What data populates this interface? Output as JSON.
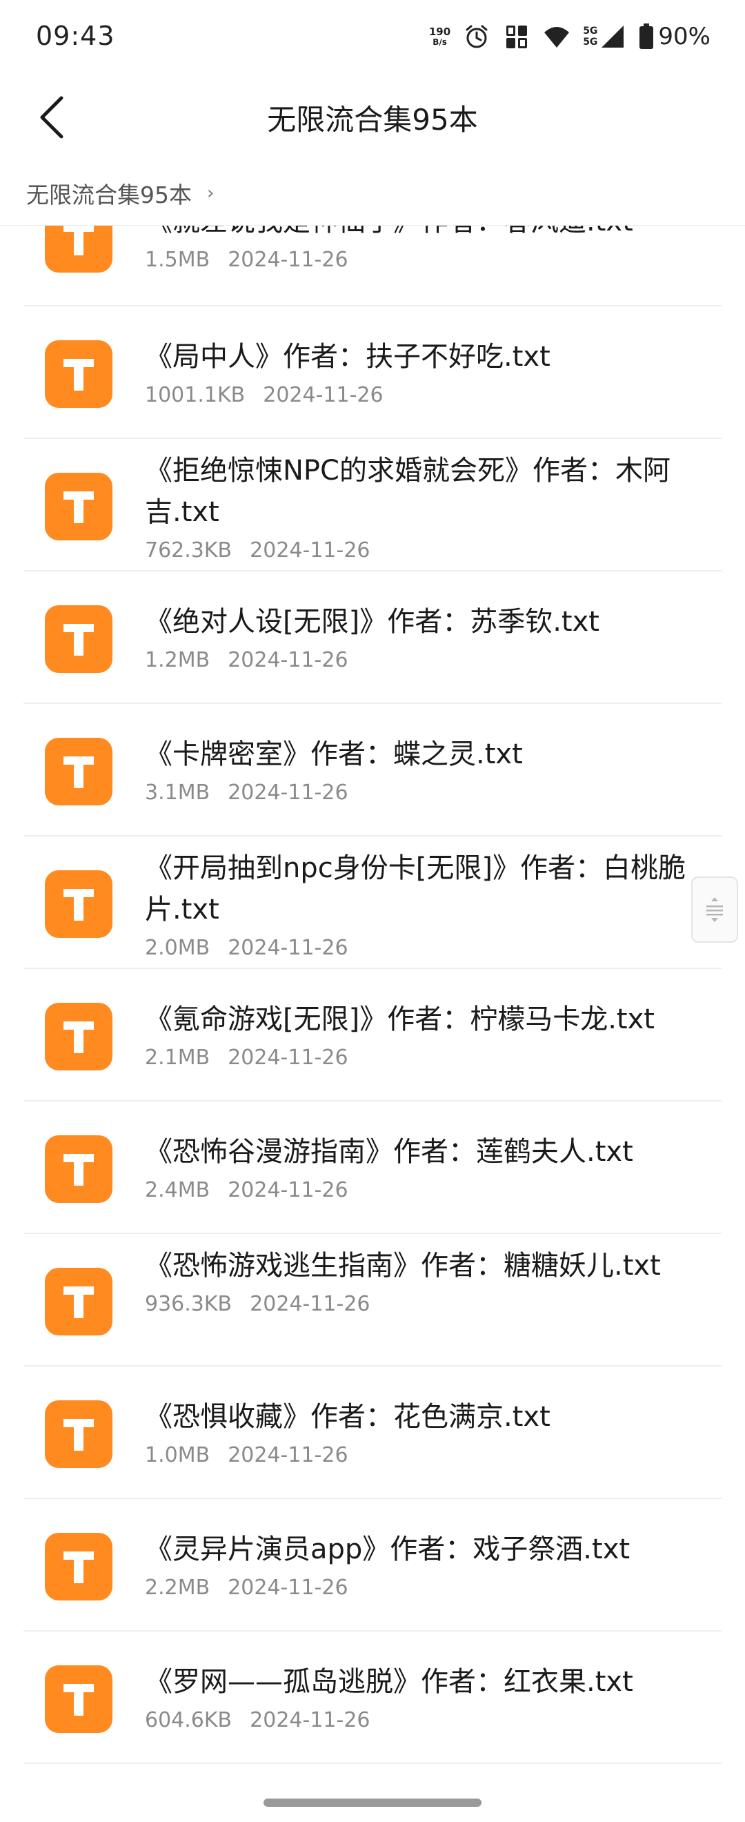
{
  "status_bar": {
    "time": "09:43",
    "net_speed_value": "190",
    "net_speed_unit": "B/s",
    "signal_label_top": "5G",
    "signal_label_bottom": "5G",
    "battery": "90%"
  },
  "header": {
    "title": "无限流合集95本",
    "back_icon": "chevron-left-icon"
  },
  "breadcrumb": {
    "label": "无限流合集95本",
    "chevron": "›"
  },
  "file_icon": {
    "letter": "T",
    "color": "#ff8a1f"
  },
  "files": [
    {
      "name": "《就差说我是神仙了》作者：春风遥.txt",
      "size": "1.5MB",
      "date": "2024-11-26"
    },
    {
      "name": "《局中人》作者：扶子不好吃.txt",
      "size": "1001.1KB",
      "date": "2024-11-26"
    },
    {
      "name": "《拒绝惊悚NPC的求婚就会死》作者：木阿吉.txt",
      "size": "762.3KB",
      "date": "2024-11-26"
    },
    {
      "name": "《绝对人设[无限]》作者：苏季钦.txt",
      "size": "1.2MB",
      "date": "2024-11-26"
    },
    {
      "name": "《卡牌密室》作者：蝶之灵.txt",
      "size": "3.1MB",
      "date": "2024-11-26"
    },
    {
      "name": "《开局抽到npc身份卡[无限]》作者：白桃脆片.txt",
      "size": "2.0MB",
      "date": "2024-11-26"
    },
    {
      "name": "《氪命游戏[无限]》作者：柠檬马卡龙.txt",
      "size": "2.1MB",
      "date": "2024-11-26"
    },
    {
      "name": "《恐怖谷漫游指南》作者：莲鹤夫人.txt",
      "size": "2.4MB",
      "date": "2024-11-26"
    },
    {
      "name": "《恐怖游戏逃生指南》作者：糖糖妖儿.txt",
      "size": "936.3KB",
      "date": "2024-11-26"
    },
    {
      "name": "《恐惧收藏》作者：花色满京.txt",
      "size": "1.0MB",
      "date": "2024-11-26"
    },
    {
      "name": "《灵异片演员app》作者：戏子祭酒.txt",
      "size": "2.2MB",
      "date": "2024-11-26"
    },
    {
      "name": "《罗网——孤岛逃脱》作者：红衣果.txt",
      "size": "604.6KB",
      "date": "2024-11-26"
    }
  ]
}
